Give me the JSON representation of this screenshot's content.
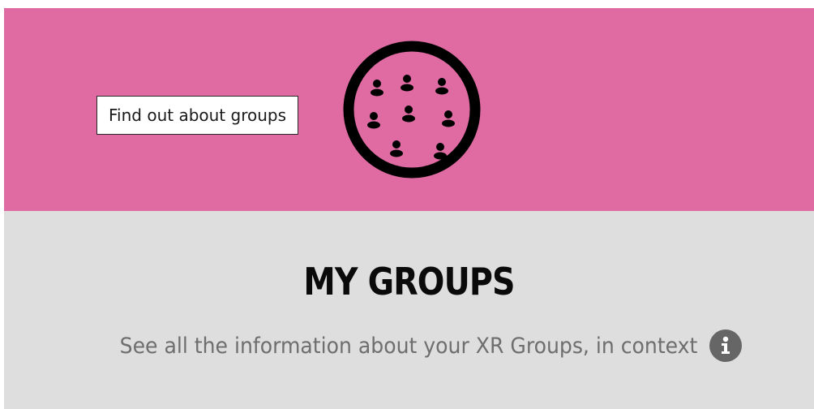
{
  "banner": {
    "background_color": "#e06ba3",
    "tooltip_text": "Find out about groups",
    "icon": "people-circle-icon"
  },
  "section": {
    "background_color": "#dedede",
    "title": "MY GROUPS",
    "subtitle": "See all the information about your XR Groups, in context",
    "info_icon": "info-icon"
  }
}
